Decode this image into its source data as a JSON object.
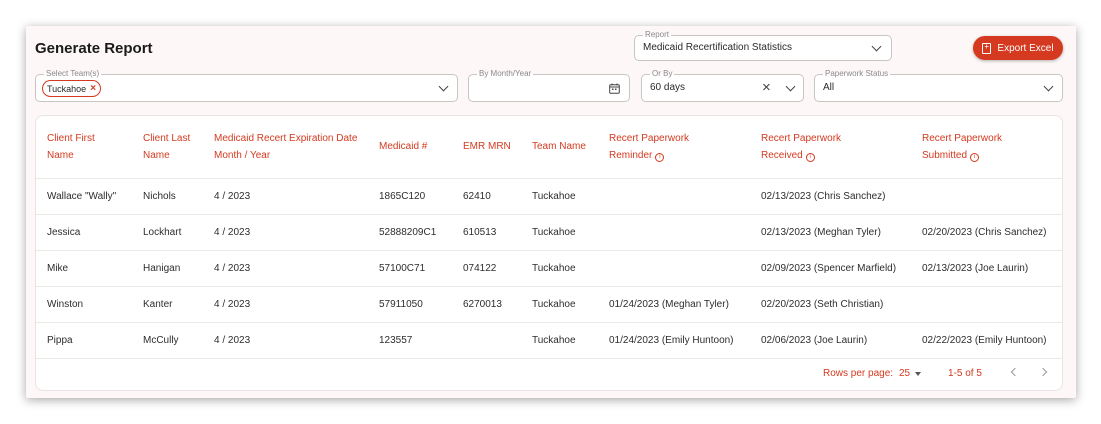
{
  "header": {
    "title": "Generate Report"
  },
  "report": {
    "label": "Report",
    "value": "Medicaid Recertification Statistics"
  },
  "export": {
    "label": "Export Excel"
  },
  "filters": {
    "teams": {
      "label": "Select Team(s)",
      "chips": [
        "Tuckahoe"
      ]
    },
    "month": {
      "label": "By Month/Year",
      "value": ""
    },
    "orby": {
      "label": "Or By",
      "value": "60 days"
    },
    "status": {
      "label": "Paperwork Status",
      "value": "All"
    }
  },
  "table": {
    "headers": [
      [
        "Client First",
        "Name"
      ],
      [
        "Client Last",
        "Name"
      ],
      [
        "Medicaid Recert Expiration Date",
        "Month / Year"
      ],
      [
        "Medicaid #"
      ],
      [
        "EMR MRN"
      ],
      [
        "Team Name"
      ],
      [
        "Recert Paperwork",
        "Reminder"
      ],
      [
        "Recert Paperwork",
        "Received"
      ],
      [
        "Recert Paperwork",
        "Submitted"
      ]
    ],
    "rows": [
      [
        "Wallace \"Wally\"",
        "Nichols",
        "4 / 2023",
        "1865C120",
        "62410",
        "Tuckahoe",
        "",
        "02/13/2023 (Chris Sanchez)",
        ""
      ],
      [
        "Jessica",
        "Lockhart",
        "4 / 2023",
        "52888209C1",
        "610513",
        "Tuckahoe",
        "",
        "02/13/2023 (Meghan Tyler)",
        "02/20/2023 (Chris Sanchez)"
      ],
      [
        "Mike",
        "Hanigan",
        "4 / 2023",
        "57100C71",
        "074122",
        "Tuckahoe",
        "",
        "02/09/2023 (Spencer Marfield)",
        "02/13/2023 (Joe Laurin)"
      ],
      [
        "Winston",
        "Kanter",
        "4 / 2023",
        "57911050",
        "6270013",
        "Tuckahoe",
        "01/24/2023 (Meghan Tyler)",
        "02/20/2023 (Seth Christian)",
        ""
      ],
      [
        "Pippa",
        "McCully",
        "4 / 2023",
        "123557",
        "",
        "Tuckahoe",
        "01/24/2023 (Emily Huntoon)",
        "02/06/2023 (Joe Laurin)",
        "02/22/2023 (Emily Huntoon)"
      ]
    ]
  },
  "pagination": {
    "rows_label": "Rows per page:",
    "rows_value": "25",
    "range": "1-5 of 5"
  }
}
